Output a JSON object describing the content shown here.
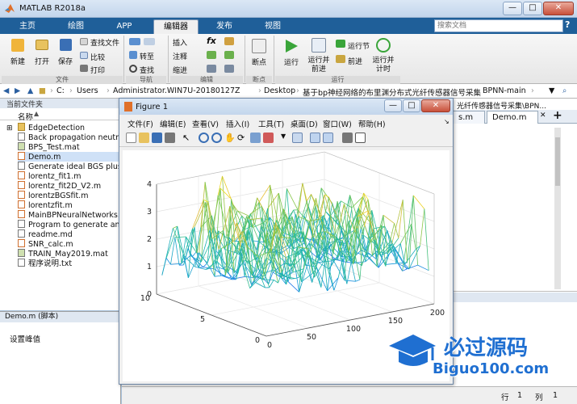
{
  "window": {
    "title": "MATLAB R2018a",
    "controls": [
      "—",
      "□",
      "✕"
    ]
  },
  "tabs": [
    "主页",
    "绘图",
    "APP",
    "编辑器",
    "发布",
    "视图"
  ],
  "active_tab": "编辑器",
  "search": {
    "placeholder": "搜索文档"
  },
  "help": "?",
  "ribbon": {
    "file": {
      "new": "新建",
      "open": "打开",
      "save": "保存",
      "find_files": "查找文件",
      "compare": "比较",
      "print": "打印",
      "group": "文件"
    },
    "navigate": {
      "goto": "转至",
      "find": "查找",
      "group": "导航"
    },
    "edit": {
      "insert": "插入",
      "comment": "注释",
      "indent": "缩进",
      "fx": "fx",
      "group": "编辑"
    },
    "breakpoints": {
      "bp": "断点",
      "group": "断点"
    },
    "run": {
      "run": "运行",
      "run_advance": "运行并前进",
      "run_section": "运行节",
      "advance": "前进",
      "run_time": "运行并计时",
      "group": "运行"
    }
  },
  "address": [
    "C:",
    "Users",
    "Administrator.WIN7U-20180127Z",
    "Desktop",
    "基于bp神经网络的布里渊分布式光纤传感器信号采集",
    "BPNN-main"
  ],
  "left_panel": {
    "title": "当前文件夹",
    "column": "名称",
    "files": [
      "EdgeDetection",
      "Back propagation neutral",
      "BPS_Test.mat",
      "Demo.m",
      "Generate ideal BGS plus m",
      "lorentz_fit1.m",
      "lorentz_fit2D_V2.m",
      "lorentzBGSfit.m",
      "lorentzfit.m",
      "MainBPNeuralNetworks.m",
      "Program to generate an ic",
      "readme.md",
      "SNR_calc.m",
      "TRAIN_May2019.mat",
      "程序说明.txt"
    ],
    "selected": "Demo.m"
  },
  "details": {
    "title": "Demo.m  (脚本)",
    "text": "设置峰值"
  },
  "editor": {
    "path_tail": "光纤传感器信号采集\\BPN...",
    "tabs": [
      "s.m",
      "Demo.m"
    ],
    "add": "+"
  },
  "status": {
    "row_label": "行",
    "row": "1",
    "col_label": "列",
    "col": "1"
  },
  "figure": {
    "title": "Figure 1",
    "menu": [
      "文件(F)",
      "编辑(E)",
      "查看(V)",
      "插入(I)",
      "工具(T)",
      "桌面(D)",
      "窗口(W)",
      "帮助(H)"
    ],
    "z_ticks": [
      "0",
      "1",
      "2",
      "3",
      "4"
    ],
    "y_ticks": [
      "0",
      "5",
      "10"
    ],
    "x_ticks": [
      "0",
      "50",
      "100",
      "150",
      "200"
    ]
  },
  "watermark": {
    "cn": "必过源码",
    "en": "Biguo100.com"
  },
  "chart_data": {
    "type": "mesh3d",
    "x_range": [
      0,
      200
    ],
    "y_range": [
      0,
      10
    ],
    "zlim": [
      0,
      4
    ],
    "x_ticks": [
      0,
      50,
      100,
      150,
      200
    ],
    "y_ticks": [
      0,
      5,
      10
    ],
    "z_ticks": [
      0,
      1,
      2,
      3,
      4
    ],
    "colormap": "parula",
    "grid": true
  }
}
